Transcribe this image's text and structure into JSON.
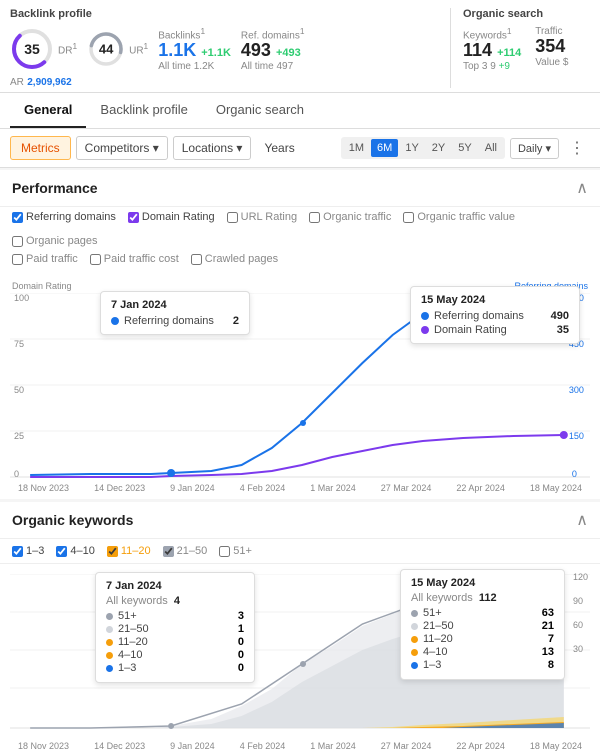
{
  "backlink_profile": {
    "title": "Backlink profile",
    "dr_label": "DR",
    "dr_sup": "1",
    "dr_value": "35",
    "ur_label": "UR",
    "ur_sup": "1",
    "ur_value": "44",
    "ar_label": "AR",
    "ar_value": "2,909,962",
    "backlinks_label": "Backlinks",
    "backlinks_sup": "1",
    "backlinks_value": "1.1K",
    "backlinks_delta": "+1.1K",
    "backlinks_alltime": "All time 1.2K",
    "ref_domains_label": "Ref. domains",
    "ref_domains_sup": "1",
    "ref_domains_value": "493",
    "ref_domains_delta": "+493",
    "ref_domains_alltime": "All time 497"
  },
  "organic_search": {
    "title": "Organic search",
    "keywords_label": "Keywords",
    "keywords_sup": "1",
    "keywords_value": "114",
    "keywords_delta": "+114",
    "keywords_sub": "Top 3 9",
    "keywords_sub2": "+9",
    "traffic_label": "Traffic",
    "traffic_value": "354",
    "traffic_sub": "Value $"
  },
  "nav_tabs": [
    {
      "label": "General",
      "active": true
    },
    {
      "label": "Backlink profile",
      "active": false
    },
    {
      "label": "Organic search",
      "active": false
    }
  ],
  "toolbar": {
    "metrics_label": "Metrics",
    "competitors_label": "Competitors",
    "locations_label": "Locations",
    "years_label": "Years",
    "time_buttons": [
      "1M",
      "6M",
      "1Y",
      "2Y",
      "5Y",
      "All"
    ],
    "active_time": "6M",
    "daily_label": "Daily"
  },
  "performance": {
    "title": "Performance",
    "checkboxes": [
      {
        "label": "Referring domains",
        "checked": true,
        "color": "#1a73e8"
      },
      {
        "label": "Domain Rating",
        "checked": true,
        "color": "#7c3aed"
      },
      {
        "label": "URL Rating",
        "checked": false,
        "color": "#888"
      },
      {
        "label": "Organic traffic",
        "checked": false,
        "color": "#888"
      },
      {
        "label": "Organic traffic value",
        "checked": false,
        "color": "#888"
      },
      {
        "label": "Organic pages",
        "checked": false,
        "color": "#888"
      },
      {
        "label": "Paid traffic",
        "checked": false,
        "color": "#888"
      },
      {
        "label": "Paid traffic cost",
        "checked": false,
        "color": "#888"
      },
      {
        "label": "Crawled pages",
        "checked": false,
        "color": "#888"
      }
    ],
    "y_left_label": "Domain Rating",
    "y_right_label": "Referring domains",
    "y_left_max": "100",
    "y_left_75": "75",
    "y_left_50": "50",
    "y_left_25": "25",
    "y_right_600": "600",
    "y_right_450": "450",
    "y_right_300": "300",
    "y_right_150": "150",
    "x_labels": [
      "18 Nov 2023",
      "14 Dec 2023",
      "9 Jan 2024",
      "4 Feb 2024",
      "1 Mar 2024",
      "27 Mar 2024",
      "22 Apr 2024",
      "18 May 2024"
    ],
    "tooltip1": {
      "date": "7 Jan 2024",
      "rows": [
        {
          "label": "Referring domains",
          "value": "2",
          "color": "#1a73e8"
        }
      ]
    },
    "tooltip2": {
      "date": "15 May 2024",
      "rows": [
        {
          "label": "Referring domains",
          "value": "490",
          "color": "#1a73e8"
        },
        {
          "label": "Domain Rating",
          "value": "35",
          "color": "#7c3aed"
        }
      ]
    }
  },
  "organic_keywords": {
    "title": "Organic keywords",
    "checkboxes": [
      {
        "label": "1–3",
        "checked": true,
        "color": "#1a73e8"
      },
      {
        "label": "4–10",
        "checked": true,
        "color": "#1a73e8"
      },
      {
        "label": "11–20",
        "checked": true,
        "color": "#f59e0b"
      },
      {
        "label": "21–50",
        "checked": true,
        "color": "#d1d5db"
      },
      {
        "label": "51+",
        "checked": false,
        "color": "#d1d5db"
      }
    ],
    "y_right_labels": [
      "120",
      "90",
      "60",
      "30"
    ],
    "x_labels": [
      "18 Nov 2023",
      "14 Dec 2023",
      "9 Jan 2024",
      "4 Feb 2024",
      "1 Mar 2024",
      "27 Mar 2024",
      "22 Apr 2024",
      "18 May 2024"
    ],
    "tooltip1": {
      "date": "7 Jan 2024",
      "all_kw": "4",
      "rows": [
        {
          "label": "51+",
          "value": "3",
          "color": "#9ca3af"
        },
        {
          "label": "21–50",
          "value": "1",
          "color": "#d1d5db"
        },
        {
          "label": "11–20",
          "value": "0",
          "color": "#f59e0b"
        },
        {
          "label": "4–10",
          "value": "0",
          "color": "#f59e0b"
        },
        {
          "label": "1–3",
          "value": "0",
          "color": "#1a73e8"
        }
      ]
    },
    "tooltip2": {
      "date": "15 May 2024",
      "all_kw": "112",
      "rows": [
        {
          "label": "51+",
          "value": "63",
          "color": "#9ca3af"
        },
        {
          "label": "21–50",
          "value": "21",
          "color": "#d1d5db"
        },
        {
          "label": "11–20",
          "value": "7",
          "color": "#f59e0b"
        },
        {
          "label": "4–10",
          "value": "13",
          "color": "#f59e0b"
        },
        {
          "label": "1–3",
          "value": "8",
          "color": "#1a73e8"
        }
      ]
    }
  }
}
